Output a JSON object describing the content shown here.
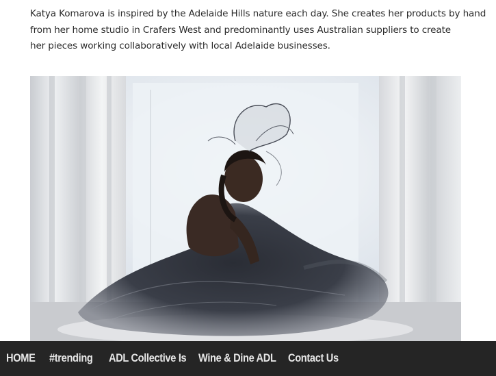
{
  "intro": {
    "line1": "Katya Komarova is inspired by the Adelaide Hills nature each day. She creates her products by hand",
    "line2": "from her home studio in Crafers West and predominantly uses Australian suppliers to create",
    "line3": "her pieces working collaboratively with local Adelaide businesses."
  },
  "photo": {
    "subject": "woman-in-tulle-dress-icon"
  },
  "nav": {
    "items": [
      {
        "label": "HOME"
      },
      {
        "label": "#trending"
      },
      {
        "label": "ADL Collective Is"
      },
      {
        "label": "Wine & Dine ADL"
      },
      {
        "label": "Contact Us"
      }
    ]
  },
  "colors": {
    "nav_background": "#252525",
    "nav_text": "#e6e6e6",
    "body_text": "#2b2b2b"
  }
}
